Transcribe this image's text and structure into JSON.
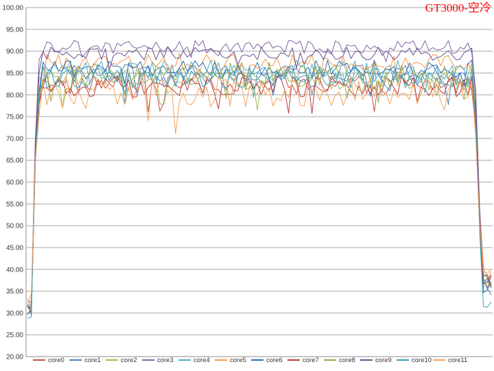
{
  "chart_data": {
    "type": "line",
    "title": "GT3000-空冷",
    "title_color": "#ff0000",
    "xlabel": "",
    "ylabel": "",
    "ylim": [
      20,
      100
    ],
    "yticks": [
      "20.00",
      "25.00",
      "30.00",
      "35.00",
      "40.00",
      "45.00",
      "50.00",
      "55.00",
      "60.00",
      "65.00",
      "70.00",
      "75.00",
      "80.00",
      "85.00",
      "90.00",
      "95.00",
      "100.00"
    ],
    "grid": true,
    "legend_position": "bottom",
    "x_points": 120,
    "series": [
      {
        "name": "core0",
        "color": "#c0504d",
        "plateau": 82.5,
        "spread": 2.5,
        "start": 31,
        "end": 34
      },
      {
        "name": "core1",
        "color": "#4f81bd",
        "plateau": 84.5,
        "spread": 2.5,
        "start": 31,
        "end": 33
      },
      {
        "name": "core2",
        "color": "#9bbb59",
        "plateau": 83.5,
        "spread": 2.5,
        "start": 31,
        "end": 34
      },
      {
        "name": "core3",
        "color": "#8064a2",
        "plateau": 91.0,
        "spread": 1.5,
        "start": 32,
        "end": 34
      },
      {
        "name": "core4",
        "color": "#4bacc6",
        "plateau": 85.5,
        "spread": 2.5,
        "start": 31,
        "end": 33
      },
      {
        "name": "core5",
        "color": "#f79646",
        "plateau": 87.5,
        "spread": 2.0,
        "start": 32,
        "end": 36
      },
      {
        "name": "core6",
        "color": "#2c6fb0",
        "plateau": 86.0,
        "spread": 2.0,
        "start": 30,
        "end": 33
      },
      {
        "name": "core7",
        "color": "#b83b3b",
        "plateau": 82.0,
        "spread": 2.5,
        "start": 30,
        "end": 34
      },
      {
        "name": "core8",
        "color": "#8ea74a",
        "plateau": 85.0,
        "spread": 2.5,
        "start": 31,
        "end": 35
      },
      {
        "name": "core9",
        "color": "#6a4f91",
        "plateau": 89.5,
        "spread": 1.5,
        "start": 31,
        "end": 34
      },
      {
        "name": "core10",
        "color": "#3aa0b8",
        "plateau": 84.0,
        "spread": 2.5,
        "start": 30,
        "end": 30
      },
      {
        "name": "core11",
        "color": "#f4a25a",
        "plateau": 80.5,
        "spread": 3.5,
        "start": 33,
        "end": 37
      }
    ]
  }
}
